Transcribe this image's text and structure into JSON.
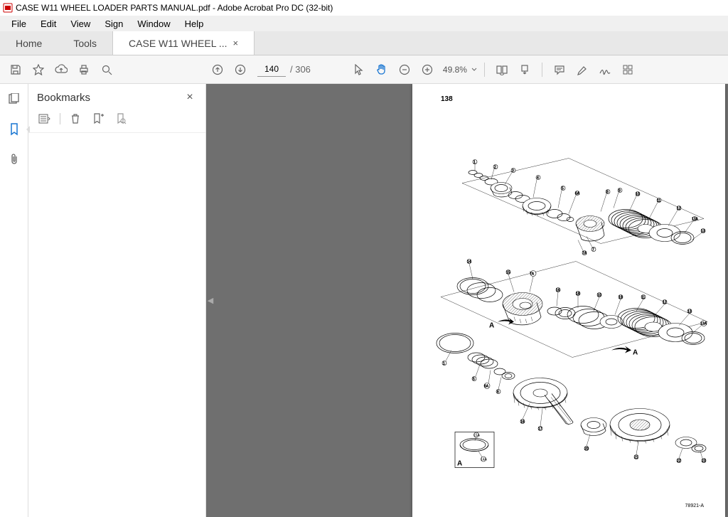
{
  "window": {
    "title": "CASE W11 WHEEL LOADER PARTS MANUAL.pdf - Adobe Acrobat Pro DC (32-bit)"
  },
  "menu": {
    "file": "File",
    "edit": "Edit",
    "view": "View",
    "sign": "Sign",
    "window": "Window",
    "help": "Help"
  },
  "tabs": {
    "home": "Home",
    "tools": "Tools",
    "doc": "CASE W11 WHEEL ..."
  },
  "toolbar": {
    "page_current": "140",
    "page_total": "/ 306",
    "zoom": "49.8%"
  },
  "bookmarks": {
    "title": "Bookmarks"
  },
  "doc": {
    "page_number": "138",
    "ref_number": "78921-A",
    "detail_label": "A"
  }
}
